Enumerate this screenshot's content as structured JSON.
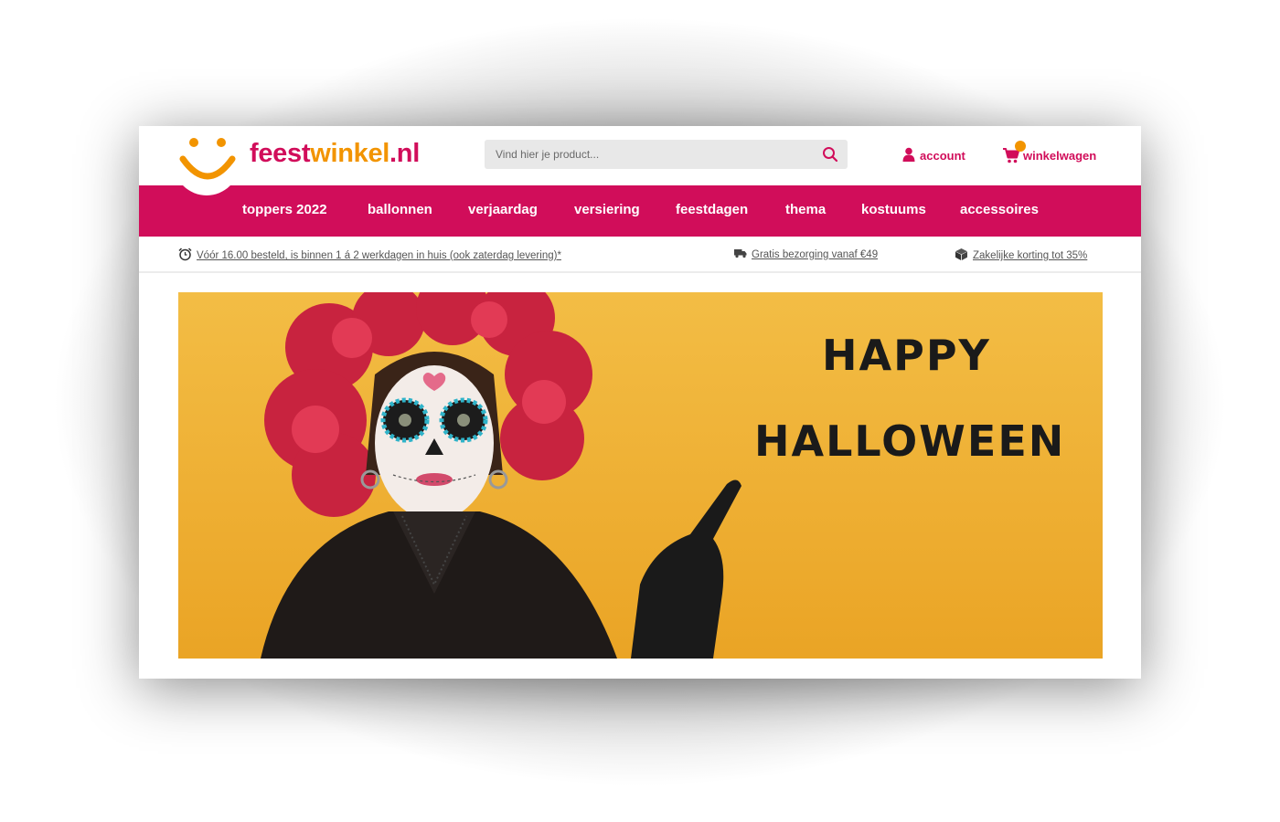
{
  "brand": {
    "part1": "feest",
    "part2": "winkel",
    "part3": ".nl"
  },
  "search": {
    "placeholder": "Vind hier je product..."
  },
  "header": {
    "account_label": "account",
    "cart_label": "winkelwagen"
  },
  "nav": {
    "items": [
      {
        "label": "toppers 2022"
      },
      {
        "label": "ballonnen"
      },
      {
        "label": "verjaardag"
      },
      {
        "label": "versiering"
      },
      {
        "label": "feestdagen"
      },
      {
        "label": "thema"
      },
      {
        "label": "kostuums"
      },
      {
        "label": "accessoires"
      }
    ]
  },
  "usp": {
    "delivery": "Vóór 16.00 besteld, is binnen 1 á 2 werkdagen in huis (ook zaterdag levering)*",
    "shipping": "Gratis bezorging vanaf €49",
    "business": "Zakelijke korting tot 35%"
  },
  "hero": {
    "line1": "HAPPY",
    "line2": "HALLOWEEN"
  },
  "colors": {
    "brand_pink": "#d10d5a",
    "brand_orange": "#f29400",
    "hero_bg": "#f0b43a"
  },
  "icons": {
    "search": "search-icon",
    "account": "user-icon",
    "cart": "cart-icon",
    "clock": "alarm-clock-icon",
    "truck": "truck-icon",
    "box": "box-icon"
  }
}
